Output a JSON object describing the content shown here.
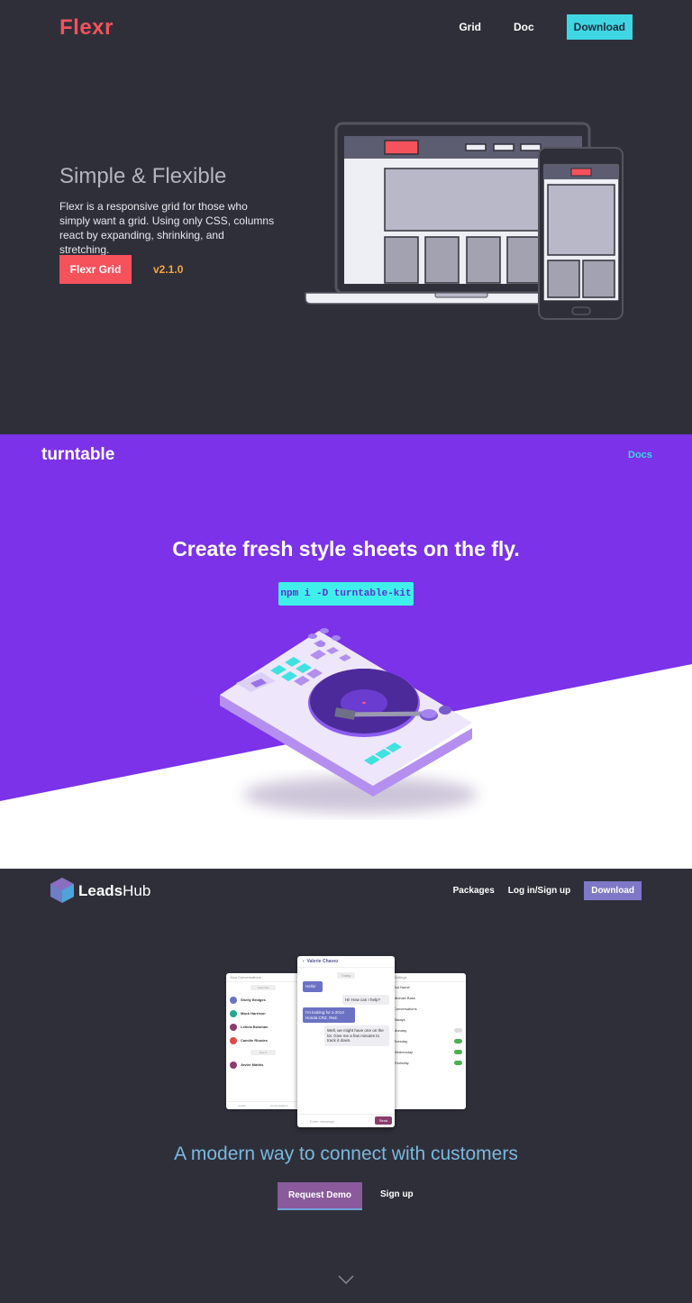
{
  "flexr": {
    "logo": "Flexr",
    "nav": {
      "grid": "Grid",
      "doc": "Doc",
      "download": "Download"
    },
    "title": "Simple & Flexible",
    "description": "Flexr is a responsive grid for those who simply want a grid. Using only CSS, columns react by expanding, shrinking, and stretching.",
    "button": "Flexr Grid",
    "version": "v2.1.0",
    "colors": {
      "brand": "#f5525c",
      "accent": "#3fd6e4",
      "version": "#f7a53b",
      "background": "#2f2f3a"
    }
  },
  "turntable": {
    "logo": "turntable",
    "nav": {
      "docs": "Docs"
    },
    "headline": "Create fresh style sheets on the fly.",
    "install_command": "npm i -D turntable-kit",
    "colors": {
      "background": "#7b32e8",
      "accent": "#3ff0ea"
    }
  },
  "leadshub": {
    "logo_bold": "Leads",
    "logo_light": "Hub",
    "nav": {
      "packages": "Packages",
      "login": "Log in/Sign up",
      "download": "Download"
    },
    "headline": "A modern way to connect with customers",
    "cta_primary": "Request Demo",
    "cta_secondary": "Sign up",
    "scroll_icon": "chevron-down-icon",
    "colors": {
      "background": "#2f2f3a",
      "headline": "#7bb8de",
      "cta": "#8a5a9c",
      "nav_button": "#7e78c6"
    },
    "mockup_left": {
      "header": "Your Conversations",
      "separator_top": "Yesterday",
      "conversations": [
        "Shelly Bridges",
        "Mack Harrison",
        "Leticia Bowman",
        "Camille Rhodes"
      ],
      "separator_bottom": "Nov 6",
      "last_conversation": "Javier Mathis",
      "tabs": [
        "Leads",
        "Conversations"
      ]
    },
    "mockup_center": {
      "contact": "Valerie Chavez",
      "day": "Today",
      "messages": [
        {
          "text": "Hello!",
          "time": "3:15pm"
        },
        {
          "text": "Hi! How can I help?",
          "time": "3:16pm"
        },
        {
          "text": "I'm looking for a 2014 Honda CRZ. Red.",
          "time": "3:16pm"
        },
        {
          "text": "Well, we might have one on the lot. Give me a few minutes to track it down.",
          "time": "3:17pm"
        }
      ],
      "input_placeholder": "Enter message...",
      "send": "Send"
    },
    "mockup_right": {
      "header": "Settings",
      "items": [
        "Bot Name",
        "Michael Bass",
        "Conversations",
        "Always",
        "Monday",
        "Tuesday",
        "Wednesday",
        "Thursday"
      ]
    }
  }
}
